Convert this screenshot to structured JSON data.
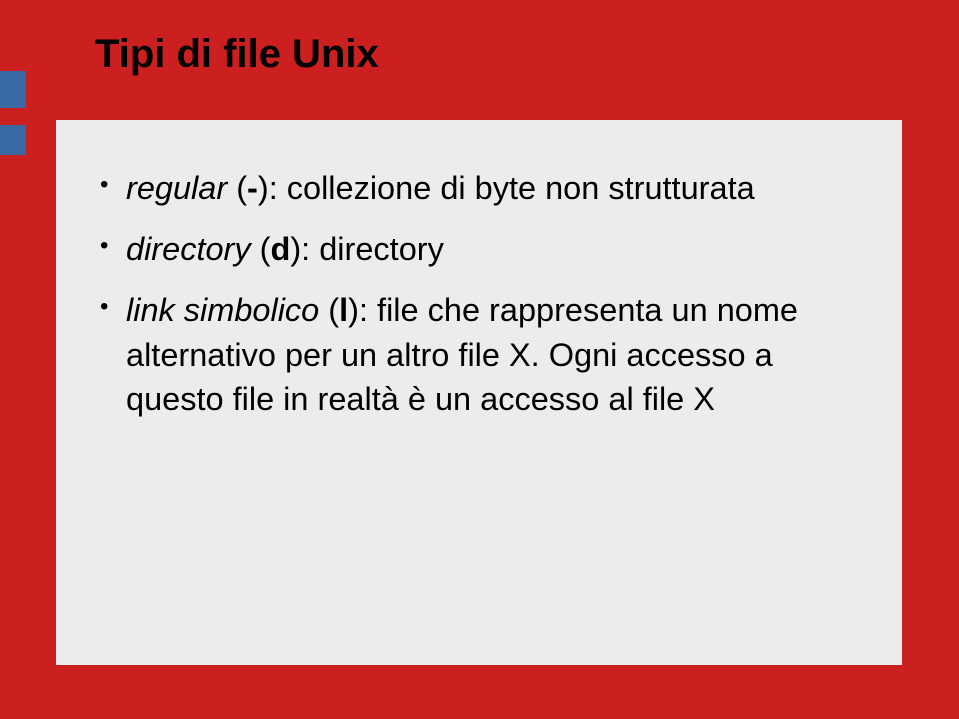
{
  "title": "Tipi di file Unix",
  "items": [
    {
      "name_it": "regular",
      "sym": "-",
      "colon": ": ",
      "desc": "collezione di byte non strutturata"
    },
    {
      "name_it": "directory",
      "sym": "d",
      "colon": ": ",
      "desc": "directory"
    },
    {
      "name_it": "link simbolico",
      "sym": "l",
      "colon": ": ",
      "desc": "file che rappresenta un nome alternativo per un altro file X. Ogni accesso a questo file in realtà è un accesso al file X"
    }
  ],
  "brackets": {
    "open": " (",
    "close": ")"
  }
}
